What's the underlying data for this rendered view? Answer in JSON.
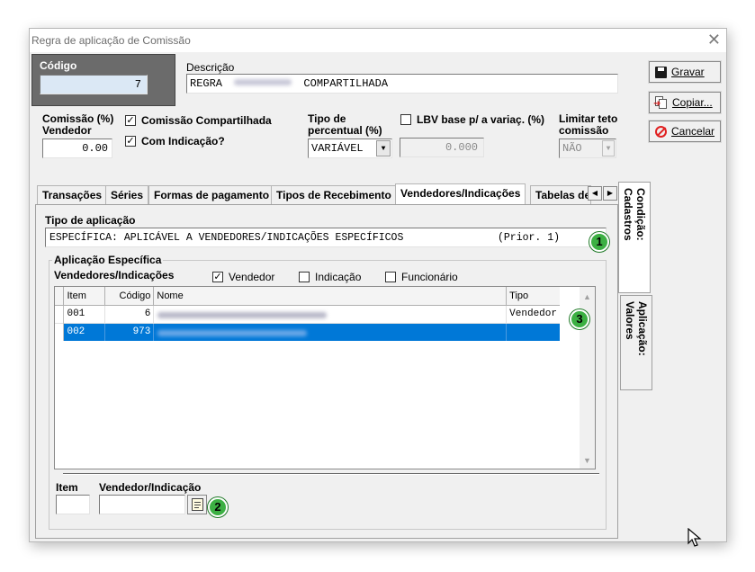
{
  "window": {
    "title": "Regra de aplicação de Comissão",
    "close_glyph": "✕"
  },
  "header": {
    "codigo_label": "Código",
    "codigo_value": "7",
    "descricao_label": "Descrição",
    "descricao_prefix": "REGRA",
    "descricao_suffix": "COMPARTILHADA"
  },
  "options": {
    "comissao_label_1": "Comissão (%)",
    "comissao_label_2": "Vendedor",
    "comissao_value": "0.00",
    "compartilhada_label": "Comissão Compartilhada",
    "compartilhada_checked": true,
    "indicacao_label": "Com Indicação?",
    "indicacao_checked": true,
    "tipo_percentual_label_1": "Tipo de",
    "tipo_percentual_label_2": "percentual (%)",
    "tipo_percentual_value": "VARIÁVEL",
    "lbv_label": "LBV base p/ a variaç. (%)",
    "lbv_checked": false,
    "lbv_value": "0.000",
    "limitar_label_1": "Limitar teto",
    "limitar_label_2": "comissão",
    "limitar_value": "NÃO"
  },
  "buttons": {
    "gravar": "Gravar",
    "copiar": "Copiar...",
    "cancelar": "Cancelar"
  },
  "tabs": [
    {
      "label": "Transações"
    },
    {
      "label": "Séries"
    },
    {
      "label": "Formas de pagamento"
    },
    {
      "label": "Tipos de Recebimento"
    },
    {
      "label": "Vendedores/Indicações"
    },
    {
      "label": "Tabelas de"
    }
  ],
  "side_tabs": {
    "condicao": "Condição: Cadastros",
    "aplicacao": "Aplicação: Valores"
  },
  "tipo_aplicacao": {
    "label": "Tipo de aplicação",
    "value": "ESPECÍFICA: APLICÁVEL A VENDEDORES/INDICAÇÕES ESPECÍFICOS",
    "prior": "(Prior. 1)"
  },
  "aplicacao_especifica": {
    "group_label": "Aplicação Específica",
    "subtitle": "Vendedores/Indicações",
    "vendedor_label": "Vendedor",
    "vendedor_checked": true,
    "indicacao_label": "Indicação",
    "indicacao_checked": false,
    "funcionario_label": "Funcionário",
    "funcionario_checked": false
  },
  "grid": {
    "columns": [
      "Item",
      "Código",
      "Nome",
      "Tipo"
    ],
    "rows": [
      {
        "item": "001",
        "codigo": "6",
        "tipo": "Vendedor"
      },
      {
        "item": "002",
        "codigo": "973",
        "tipo": ""
      }
    ]
  },
  "footer": {
    "item_label": "Item",
    "vendedor_label": "Vendedor/Indicação"
  },
  "badges": [
    "1",
    "2",
    "3"
  ],
  "colors": {
    "selection": "#0078d7",
    "badge": "#3cb043",
    "cancel_red": "#e02020"
  }
}
